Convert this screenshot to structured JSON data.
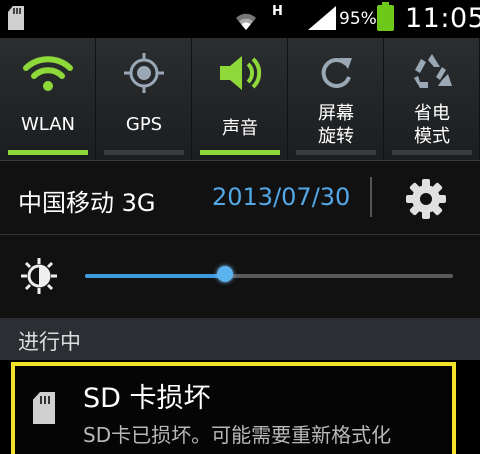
{
  "status_bar": {
    "left_icon": "sd-card-icon",
    "network_type": "H",
    "battery_percent": "95%",
    "time": "11:05",
    "battery_color": "#6ec81a"
  },
  "quick_toggles": [
    {
      "label": "WLAN",
      "icon": "wifi-icon",
      "on": true
    },
    {
      "label": "GPS",
      "icon": "gps-icon",
      "on": false
    },
    {
      "label": "声音",
      "icon": "speaker-icon",
      "on": true
    },
    {
      "label_lines": [
        "屏幕",
        "旋转"
      ],
      "icon": "rotate-icon",
      "on": false
    },
    {
      "label_lines": [
        "省电",
        "模式"
      ],
      "icon": "recycle-icon",
      "on": false
    }
  ],
  "toggle_on_color": "#8fd83a",
  "carrier_row": {
    "carrier": "中国移动 3G",
    "date": "2013/07/30",
    "date_color": "#54a8e6",
    "settings_icon": "gear-icon"
  },
  "brightness": {
    "icon": "brightness-icon",
    "level": 0.38
  },
  "ongoing": {
    "header": "进行中"
  },
  "notification": {
    "icon": "sd-card-icon",
    "title": "SD 卡损坏",
    "body": "SD卡已损坏。可能需要重新格式化",
    "highlight_color": "#f2e32a"
  }
}
